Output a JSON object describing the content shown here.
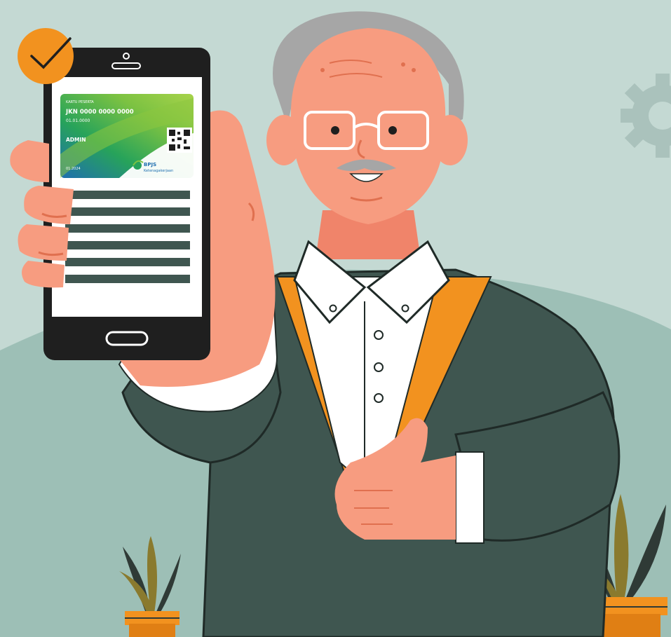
{
  "card": {
    "header": "KARTU PESERTA",
    "number": "JKN 0000 0000 0000",
    "sub": "01.01.0000",
    "name": "ADMIN",
    "date": "01.2024",
    "brand": "BPJS",
    "brand_sub": "Ketenagakerjaan"
  },
  "colors": {
    "background": "#c4d9d3",
    "hill": "#9dbfb6",
    "sweater": "#3f5650",
    "skin": "#f79c80",
    "hair": "#a6a6a6",
    "accent": "#f2921f",
    "phone": "#1f1f1f"
  },
  "icons": [
    "check-icon",
    "gear-icon",
    "qr-code-icon",
    "bpjs-logo-icon"
  ]
}
